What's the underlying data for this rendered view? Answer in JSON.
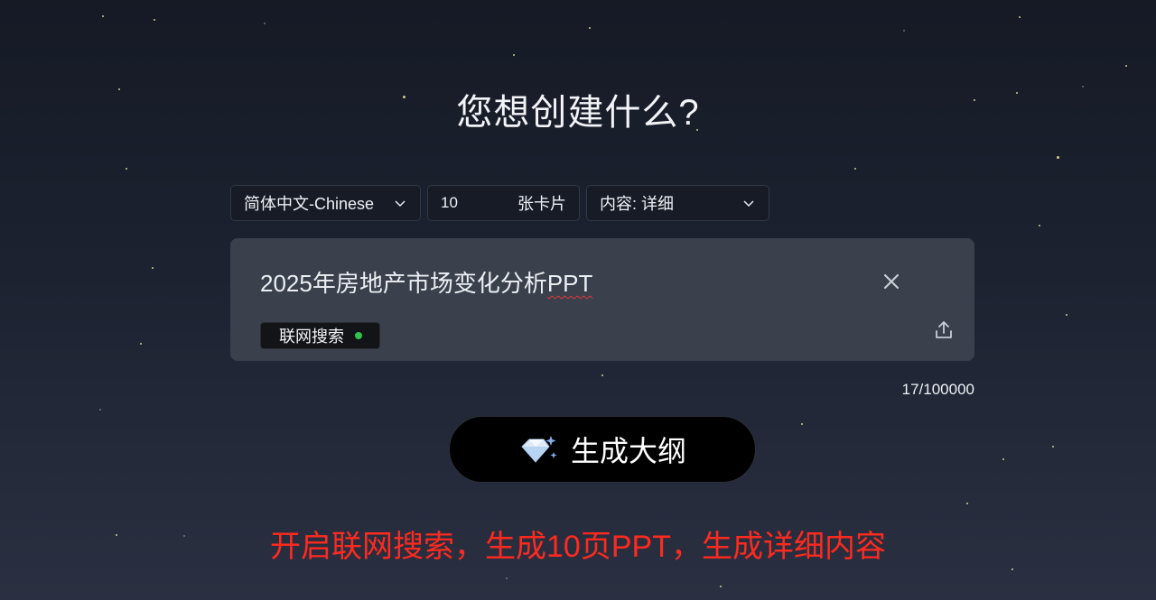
{
  "page": {
    "title": "您想创建什么?"
  },
  "options": {
    "language": "简体中文-Chinese",
    "card_count": "10",
    "card_unit": "张卡片",
    "content_detail": "内容: 详细"
  },
  "prompt": {
    "text_main": "2025年房地产市场变化分析",
    "text_underlined": "PPT",
    "web_search_label": "联网搜索",
    "web_search_status_color": "#2ec44a"
  },
  "counter": {
    "text": "17/100000"
  },
  "generate": {
    "label": "生成大纲",
    "icon": "diamond-sparkle-icon"
  },
  "annotation": {
    "text": "开启联网搜索，生成10页PPT，生成详细内容"
  },
  "colors": {
    "background_top": "#151a25",
    "prompt_box": "#3a404c",
    "annotation_red": "#ff2a1f"
  }
}
